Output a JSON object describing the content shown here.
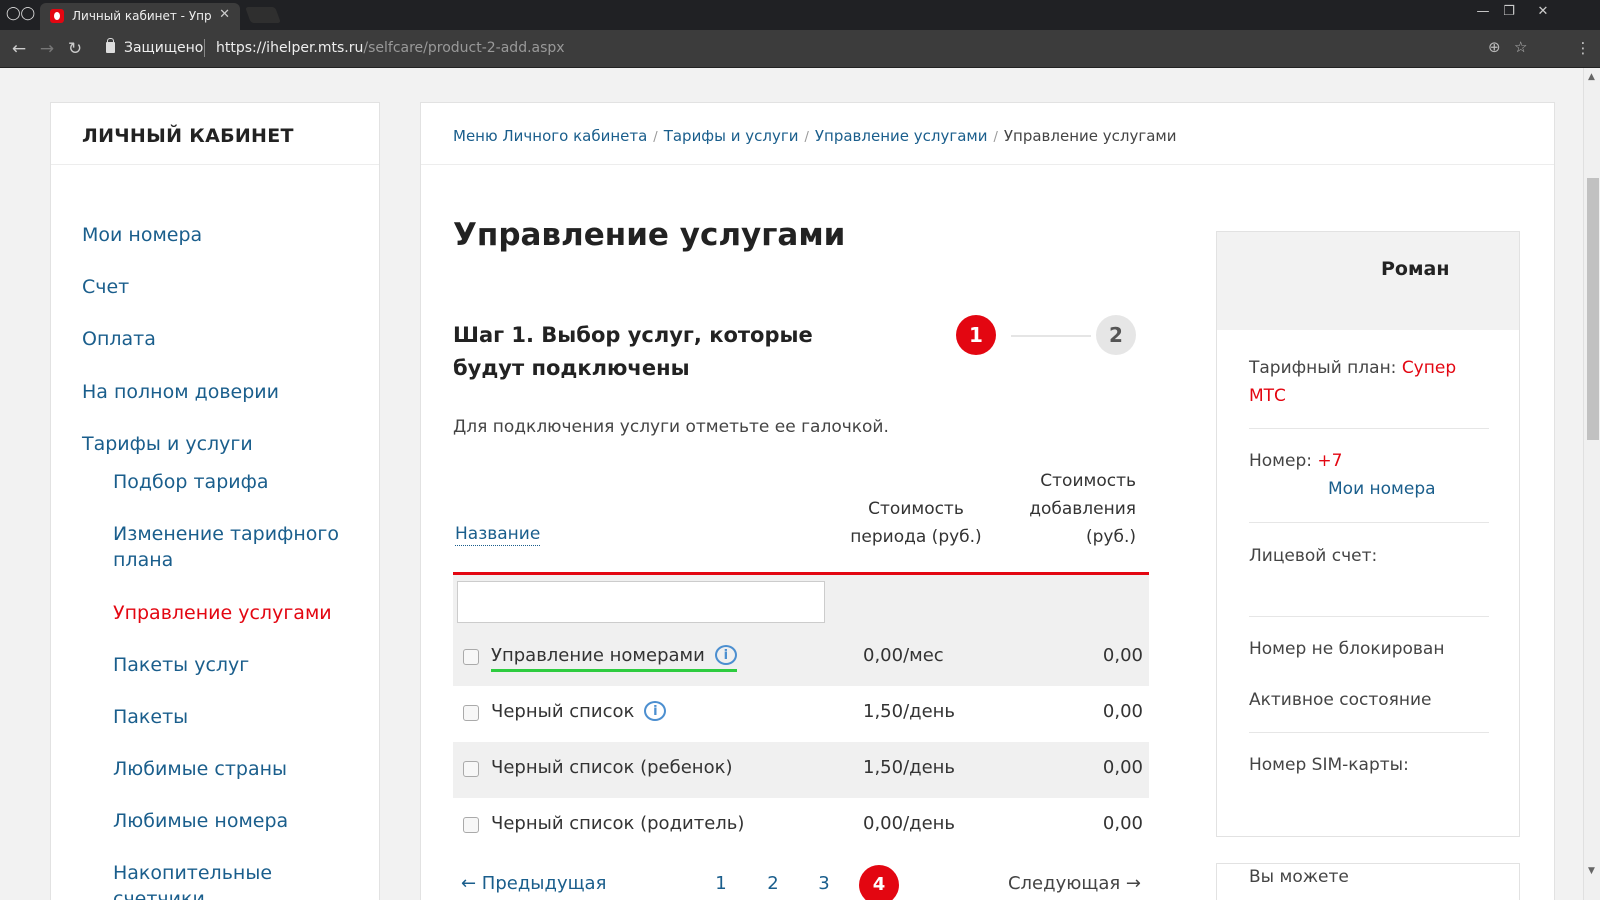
{
  "browser": {
    "tab_title": "Личный кабинет - Упра",
    "secure_label": "Защищено",
    "url_host": "https://ihelper.mts.ru",
    "url_path": "/selfcare/product-2-add.aspx"
  },
  "sidebar": {
    "title": "ЛИЧНЫЙ КАБИНЕТ",
    "items": [
      {
        "label": "Мои номера"
      },
      {
        "label": "Счет"
      },
      {
        "label": "Оплата"
      },
      {
        "label": "На полном доверии"
      },
      {
        "label": "Тарифы и услуги"
      }
    ],
    "subitems": [
      {
        "label": "Подбор тарифа"
      },
      {
        "label": "Изменение тарифного плана"
      },
      {
        "label": "Управление услугами"
      },
      {
        "label": "Пакеты услуг"
      },
      {
        "label": "Пакеты"
      },
      {
        "label": "Любимые страны"
      },
      {
        "label": "Любимые номера"
      },
      {
        "label": "Накопительные счетчики"
      }
    ]
  },
  "breadcrumb": [
    "Меню Личного кабинета",
    "Тарифы и услуги",
    "Управление услугами",
    "Управление услугами"
  ],
  "main": {
    "title": "Управление услугами",
    "step_title": "Шаг 1. Выбор услуг, которые будут подключены",
    "step1": "1",
    "step2": "2",
    "hint": "Для подключения услуги отметьте ее галочкой."
  },
  "table": {
    "col_name": "Название",
    "col_period": "Стоимость периода (руб.)",
    "col_add": "Стоимость добавления (руб.)",
    "filter_value": "",
    "rows": [
      {
        "name": "Управление номерами",
        "period": "0,00/мес",
        "add": "0,00",
        "info": "i",
        "checked": false
      },
      {
        "name": "Черный список",
        "period": "1,50/день",
        "add": "0,00",
        "info": "i",
        "checked": false
      },
      {
        "name": "Черный список (ребенок)",
        "period": "1,50/день",
        "add": "0,00",
        "checked": false
      },
      {
        "name": "Черный список (родитель)",
        "period": "0,00/день",
        "add": "0,00",
        "checked": false
      }
    ]
  },
  "pager": {
    "prev": "← Предыдущая",
    "pages": [
      "1",
      "2",
      "3"
    ],
    "current": "4",
    "next": "Следующая →"
  },
  "profile": {
    "name": "Роман",
    "tariff_label": "Тарифный план: ",
    "tariff_value": "Супер МТС",
    "number_label": "Номер: ",
    "number_value": "+7",
    "my_numbers_link": "Мои номера",
    "account_label": "Лицевой счет:",
    "block_status": "Номер не блокирован",
    "state": "Активное состояние",
    "sim_label": "Номер SIM-карты:",
    "you_can": "Вы можете"
  },
  "colors": {
    "accent": "#e30611",
    "link": "#1a5e8c",
    "highlight": "#2ecc40"
  }
}
